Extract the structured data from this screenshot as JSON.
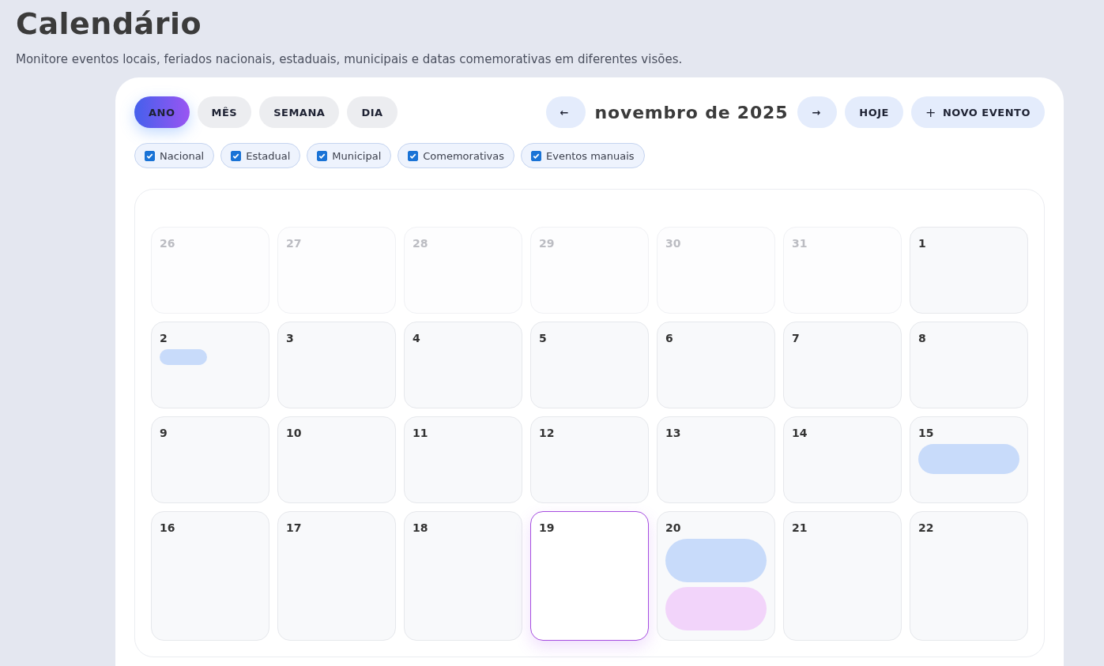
{
  "page": {
    "title": "Calendário",
    "subtitle": "Monitore eventos locais, feriados nacionais, estaduais, municipais e datas comemorativas em diferentes visões."
  },
  "views": [
    {
      "label": "ANO",
      "selected": true
    },
    {
      "label": "MÊS",
      "selected": false
    },
    {
      "label": "SEMANA",
      "selected": false
    },
    {
      "label": "DIA",
      "selected": false
    }
  ],
  "nav": {
    "prev": "←",
    "title": "novembro de 2025",
    "next": "→",
    "today": "HOJE",
    "new_event": "NOVO EVENTO",
    "new_event_icon": "+"
  },
  "filters": [
    {
      "label": "Nacional",
      "checked": true
    },
    {
      "label": "Estadual",
      "checked": true
    },
    {
      "label": "Municipal",
      "checked": true
    },
    {
      "label": "Comemorativas",
      "checked": true
    },
    {
      "label": "Eventos manuais",
      "checked": true
    }
  ],
  "weeks": [
    [
      {
        "day": "26",
        "outside": true,
        "today": false
      },
      {
        "day": "27",
        "outside": true,
        "today": false
      },
      {
        "day": "28",
        "outside": true,
        "today": false
      },
      {
        "day": "29",
        "outside": true,
        "today": false
      },
      {
        "day": "30",
        "outside": true,
        "today": false
      },
      {
        "day": "31",
        "outside": true,
        "today": false
      },
      {
        "day": "1",
        "outside": false,
        "today": false
      }
    ],
    [
      {
        "day": "2",
        "outside": false,
        "today": false,
        "events": [
          {
            "kind": "short",
            "color": "#c8dbfa"
          }
        ]
      },
      {
        "day": "3",
        "outside": false,
        "today": false
      },
      {
        "day": "4",
        "outside": false,
        "today": false
      },
      {
        "day": "5",
        "outside": false,
        "today": false
      },
      {
        "day": "6",
        "outside": false,
        "today": false
      },
      {
        "day": "7",
        "outside": false,
        "today": false
      },
      {
        "day": "8",
        "outside": false,
        "today": false
      }
    ],
    [
      {
        "day": "9",
        "outside": false,
        "today": false
      },
      {
        "day": "10",
        "outside": false,
        "today": false
      },
      {
        "day": "11",
        "outside": false,
        "today": false
      },
      {
        "day": "12",
        "outside": false,
        "today": false
      },
      {
        "day": "13",
        "outside": false,
        "today": false
      },
      {
        "day": "14",
        "outside": false,
        "today": false
      },
      {
        "day": "15",
        "outside": false,
        "today": false,
        "events": [
          {
            "kind": "wide",
            "color": "#c8dbfa"
          }
        ]
      }
    ],
    [
      {
        "day": "16",
        "outside": false,
        "today": false
      },
      {
        "day": "17",
        "outside": false,
        "today": false
      },
      {
        "day": "18",
        "outside": false,
        "today": false
      },
      {
        "day": "19",
        "outside": false,
        "today": true
      },
      {
        "day": "20",
        "outside": false,
        "today": false,
        "events": [
          {
            "kind": "tall",
            "color": "#c8dbfa"
          },
          {
            "kind": "tall",
            "color": "#f2d4fa"
          }
        ]
      },
      {
        "day": "21",
        "outside": false,
        "today": false
      },
      {
        "day": "22",
        "outside": false,
        "today": false
      }
    ]
  ]
}
